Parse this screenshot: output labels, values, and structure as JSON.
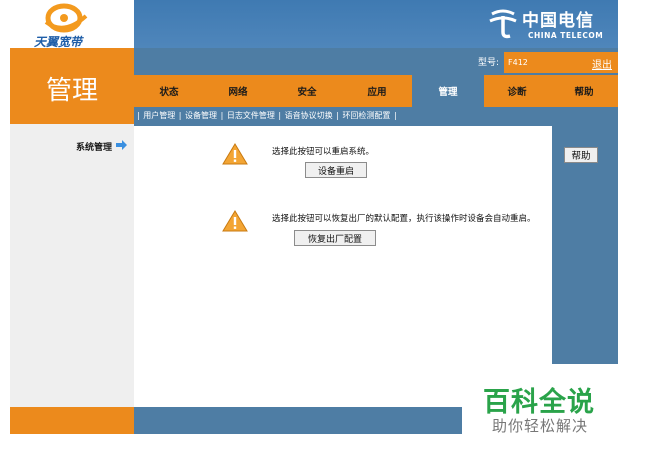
{
  "header": {
    "brand_left": "天翼宽带",
    "brand_right_cn": "中国电信",
    "brand_right_en": "CHINA TELECOM"
  },
  "section_title": "管理",
  "device": {
    "model_label": "型号:",
    "model_value": "F412",
    "logout": "退出"
  },
  "nav": {
    "tabs": [
      "状态",
      "网络",
      "安全",
      "应用",
      "管理",
      "诊断",
      "帮助"
    ],
    "active": "管理"
  },
  "subnav": {
    "items": [
      "用户管理",
      "设备管理",
      "日志文件管理",
      "语音协议切换",
      "环回检测配置"
    ]
  },
  "sidebar": {
    "item": "系统管理"
  },
  "content": {
    "reboot_msg": "选择此按钮可以重启系统。",
    "reboot_button": "设备重启",
    "restore_msg": "选择此按钮可以恢复出厂的默认配置，执行该操作时设备会自动重启。",
    "restore_button": "恢复出厂配置"
  },
  "help": {
    "button": "帮助"
  },
  "watermark": {
    "title": "百科全说",
    "subtitle": "助你轻松解决"
  },
  "colors": {
    "orange": "#ec8a1c",
    "blue": "#4e7da4",
    "green": "#2aa34a"
  },
  "icons": [
    "warning-icon",
    "arrow-right-icon",
    "telecom-logo-icon",
    "tianyi-logo-icon"
  ]
}
